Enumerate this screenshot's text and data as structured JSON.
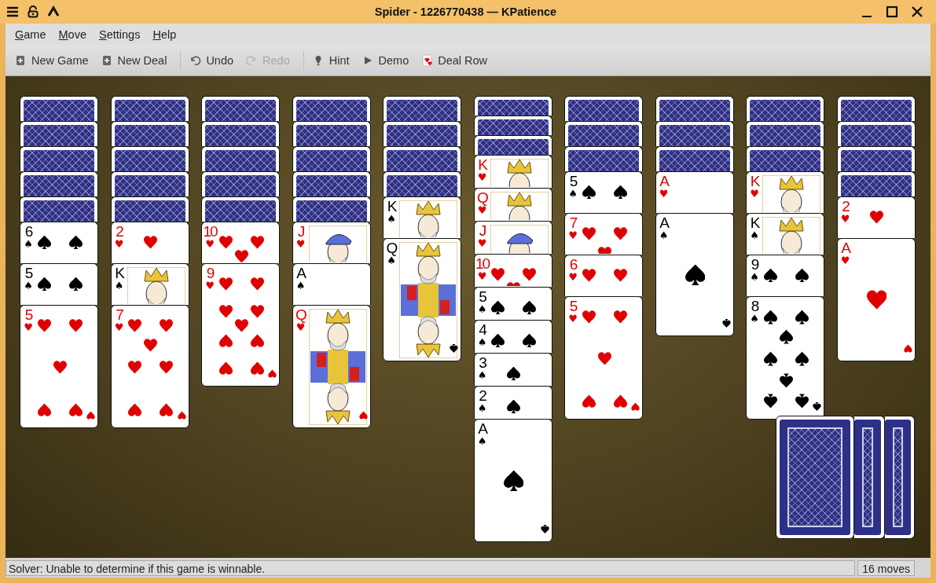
{
  "window": {
    "title": "Spider - 1226770438 — KPatience"
  },
  "menu_bar": [
    {
      "label": "Game"
    },
    {
      "label": "Move"
    },
    {
      "label": "Settings"
    },
    {
      "label": "Help"
    }
  ],
  "toolbar": {
    "groups": [
      {
        "items": [
          {
            "label": "New Game",
            "disabled": false
          },
          {
            "label": "New Deal",
            "disabled": false
          }
        ]
      },
      {
        "items": [
          {
            "label": "Undo",
            "disabled": false
          },
          {
            "label": "Redo",
            "disabled": true
          }
        ]
      },
      {
        "items": [
          {
            "label": "Hint",
            "disabled": false
          },
          {
            "label": "Demo",
            "disabled": false
          },
          {
            "label": "Deal Row",
            "disabled": false
          }
        ]
      }
    ]
  },
  "tableau": [
    {
      "cards": [
        {
          "face_up": false
        },
        {
          "face_up": false
        },
        {
          "face_up": false
        },
        {
          "face_up": false
        },
        {
          "face_up": false
        },
        {
          "face_up": true,
          "rank": "6",
          "suit": "♠",
          "color": "#000000",
          "kind": "six"
        },
        {
          "face_up": true,
          "rank": "5",
          "suit": "♠",
          "color": "#000000",
          "kind": "five"
        },
        {
          "face_up": true,
          "rank": "5",
          "suit": "♥",
          "color": "#e00000",
          "kind": "five"
        }
      ]
    },
    {
      "cards": [
        {
          "face_up": false
        },
        {
          "face_up": false
        },
        {
          "face_up": false
        },
        {
          "face_up": false
        },
        {
          "face_up": false
        },
        {
          "face_up": true,
          "rank": "2",
          "suit": "♥",
          "color": "#e00000",
          "kind": "two"
        },
        {
          "face_up": true,
          "rank": "K",
          "suit": "♠",
          "color": "#000000",
          "kind": "king"
        },
        {
          "face_up": true,
          "rank": "7",
          "suit": "♥",
          "color": "#e00000",
          "kind": "seven"
        }
      ]
    },
    {
      "cards": [
        {
          "face_up": false
        },
        {
          "face_up": false
        },
        {
          "face_up": false
        },
        {
          "face_up": false
        },
        {
          "face_up": false
        },
        {
          "face_up": true,
          "rank": "10",
          "suit": "♥",
          "color": "#e00000",
          "kind": "ten"
        },
        {
          "face_up": true,
          "rank": "9",
          "suit": "♥",
          "color": "#e00000",
          "kind": "nine"
        }
      ]
    },
    {
      "cards": [
        {
          "face_up": false
        },
        {
          "face_up": false
        },
        {
          "face_up": false
        },
        {
          "face_up": false
        },
        {
          "face_up": false
        },
        {
          "face_up": true,
          "rank": "J",
          "suit": "♥",
          "color": "#e00000",
          "kind": "jack"
        },
        {
          "face_up": true,
          "rank": "A",
          "suit": "♠",
          "color": "#000000",
          "kind": "ace"
        },
        {
          "face_up": true,
          "rank": "Q",
          "suit": "♥",
          "color": "#e00000",
          "kind": "queen"
        }
      ]
    },
    {
      "cards": [
        {
          "face_up": false
        },
        {
          "face_up": false
        },
        {
          "face_up": false
        },
        {
          "face_up": false
        },
        {
          "face_up": true,
          "rank": "K",
          "suit": "♠",
          "color": "#000000",
          "kind": "king"
        },
        {
          "face_up": true,
          "rank": "Q",
          "suit": "♠",
          "color": "#000000",
          "kind": "queen"
        }
      ]
    },
    {
      "cards": [
        {
          "face_up": false
        },
        {
          "face_up": false
        },
        {
          "face_up": false
        },
        {
          "face_up": true,
          "rank": "K",
          "suit": "♥",
          "color": "#e00000",
          "kind": "king"
        },
        {
          "face_up": true,
          "rank": "Q",
          "suit": "♥",
          "color": "#e00000",
          "kind": "queen"
        },
        {
          "face_up": true,
          "rank": "J",
          "suit": "♥",
          "color": "#e00000",
          "kind": "jack"
        },
        {
          "face_up": true,
          "rank": "10",
          "suit": "♥",
          "color": "#e00000",
          "kind": "ten"
        },
        {
          "face_up": true,
          "rank": "5",
          "suit": "♠",
          "color": "#000000",
          "kind": "five"
        },
        {
          "face_up": true,
          "rank": "4",
          "suit": "♠",
          "color": "#000000",
          "kind": "four"
        },
        {
          "face_up": true,
          "rank": "3",
          "suit": "♠",
          "color": "#000000",
          "kind": "three"
        },
        {
          "face_up": true,
          "rank": "2",
          "suit": "♠",
          "color": "#000000",
          "kind": "two"
        },
        {
          "face_up": true,
          "rank": "A",
          "suit": "♠",
          "color": "#000000",
          "kind": "ace"
        }
      ]
    },
    {
      "cards": [
        {
          "face_up": false
        },
        {
          "face_up": false
        },
        {
          "face_up": false
        },
        {
          "face_up": true,
          "rank": "5",
          "suit": "♠",
          "color": "#000000",
          "kind": "five"
        },
        {
          "face_up": true,
          "rank": "7",
          "suit": "♥",
          "color": "#e00000",
          "kind": "seven"
        },
        {
          "face_up": true,
          "rank": "6",
          "suit": "♥",
          "color": "#e00000",
          "kind": "six"
        },
        {
          "face_up": true,
          "rank": "5",
          "suit": "♥",
          "color": "#e00000",
          "kind": "five"
        }
      ]
    },
    {
      "cards": [
        {
          "face_up": false
        },
        {
          "face_up": false
        },
        {
          "face_up": false
        },
        {
          "face_up": true,
          "rank": "A",
          "suit": "♥",
          "color": "#e00000",
          "kind": "ace"
        },
        {
          "face_up": true,
          "rank": "A",
          "suit": "♠",
          "color": "#000000",
          "kind": "ace"
        }
      ]
    },
    {
      "cards": [
        {
          "face_up": false
        },
        {
          "face_up": false
        },
        {
          "face_up": false
        },
        {
          "face_up": true,
          "rank": "K",
          "suit": "♥",
          "color": "#e00000",
          "kind": "king"
        },
        {
          "face_up": true,
          "rank": "K",
          "suit": "♠",
          "color": "#000000",
          "kind": "king"
        },
        {
          "face_up": true,
          "rank": "9",
          "suit": "♠",
          "color": "#000000",
          "kind": "nine"
        },
        {
          "face_up": true,
          "rank": "8",
          "suit": "♠",
          "color": "#000000",
          "kind": "eight"
        }
      ]
    },
    {
      "cards": [
        {
          "face_up": false
        },
        {
          "face_up": false
        },
        {
          "face_up": false
        },
        {
          "face_up": false
        },
        {
          "face_up": true,
          "rank": "2",
          "suit": "♥",
          "color": "#e00000",
          "kind": "two"
        },
        {
          "face_up": true,
          "rank": "A",
          "suit": "♥",
          "color": "#e00000",
          "kind": "ace"
        }
      ]
    }
  ],
  "stock": [
    {
      "face_up": false
    },
    {
      "face_up": false
    },
    {
      "face_up": false
    }
  ],
  "status_bar": {
    "message": "Solver: Unable to determine if this game is winnable.",
    "moves": "16 moves"
  }
}
